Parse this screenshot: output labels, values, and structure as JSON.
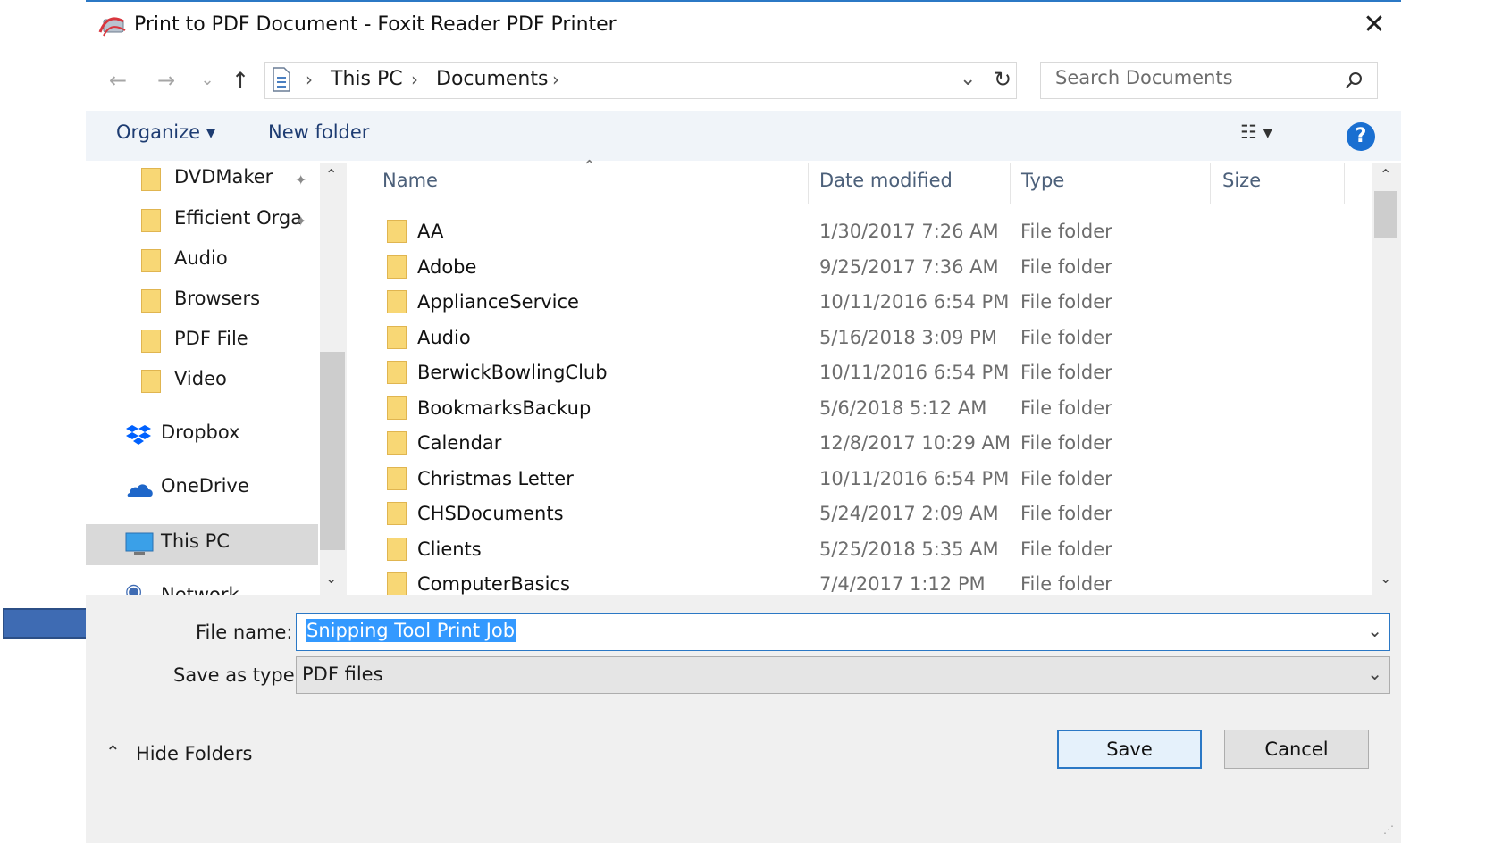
{
  "window": {
    "title": "Print to PDF Document - Foxit Reader PDF Printer",
    "close_glyph": "✕"
  },
  "address_bar": {
    "crumbs": [
      "This PC",
      "Documents"
    ],
    "separator": "›",
    "dropdown_glyph": "⌄",
    "refresh_glyph": "↻"
  },
  "search": {
    "placeholder": "Search Documents",
    "icon": "search-icon"
  },
  "nav_buttons": {
    "back": "←",
    "forward": "→",
    "recent": "⌄",
    "up": "↑"
  },
  "toolbar": {
    "organize_label": "Organize ▾",
    "new_folder_label": "New folder",
    "view_glyph": "☷ ▾",
    "help_label": "?"
  },
  "nav_pane": {
    "quick_access": [
      {
        "label": "DVDMaker",
        "pinned": true
      },
      {
        "label": "Efficient Orga",
        "pinned": true
      },
      {
        "label": "Audio",
        "pinned": false
      },
      {
        "label": "Browsers",
        "pinned": false
      },
      {
        "label": "PDF File",
        "pinned": false
      },
      {
        "label": "Video",
        "pinned": false
      }
    ],
    "locations": [
      {
        "label": "Dropbox",
        "icon": "dropbox-icon"
      },
      {
        "label": "OneDrive",
        "icon": "onedrive-icon"
      },
      {
        "label": "This PC",
        "icon": "computer-icon",
        "selected": true
      }
    ],
    "cut_off_label": "Network",
    "pin_glyph": "📌"
  },
  "file_list": {
    "columns": [
      "Name",
      "Date modified",
      "Type",
      "Size"
    ],
    "sort_glyph": "⌃",
    "rows": [
      {
        "name": "AA",
        "date": "1/30/2017 7:26 AM",
        "type": "File folder"
      },
      {
        "name": "Adobe",
        "date": "9/25/2017 7:36 AM",
        "type": "File folder"
      },
      {
        "name": "ApplianceService",
        "date": "10/11/2016 6:54 PM",
        "type": "File folder"
      },
      {
        "name": "Audio",
        "date": "5/16/2018 3:09 PM",
        "type": "File folder"
      },
      {
        "name": "BerwickBowlingClub",
        "date": "10/11/2016 6:54 PM",
        "type": "File folder"
      },
      {
        "name": "BookmarksBackup",
        "date": "5/6/2018 5:12 AM",
        "type": "File folder"
      },
      {
        "name": "Calendar",
        "date": "12/8/2017 10:29 AM",
        "type": "File folder"
      },
      {
        "name": "Christmas Letter",
        "date": "10/11/2016 6:54 PM",
        "type": "File folder"
      },
      {
        "name": "CHSDocuments",
        "date": "5/24/2017 2:09 AM",
        "type": "File folder"
      },
      {
        "name": "Clients",
        "date": "5/25/2018 5:35 AM",
        "type": "File folder"
      },
      {
        "name": "ComputerBasics",
        "date": "7/4/2017 1:12 PM",
        "type": "File folder"
      }
    ]
  },
  "save_form": {
    "file_name_label": "File name:",
    "file_name_value": "Snipping Tool Print Job",
    "save_as_type_label": "Save as type:",
    "save_as_type_value": "PDF files",
    "dropdown_glyph": "⌄"
  },
  "footer": {
    "hide_folders_label": "Hide Folders",
    "hide_folders_glyph": "⌃",
    "save_label": "Save",
    "cancel_label": "Cancel"
  },
  "colors": {
    "accent": "#2b78c5",
    "annotation_arrow": "#3e6bb3",
    "folder": "#f8d775",
    "selection": "#3399ff"
  }
}
